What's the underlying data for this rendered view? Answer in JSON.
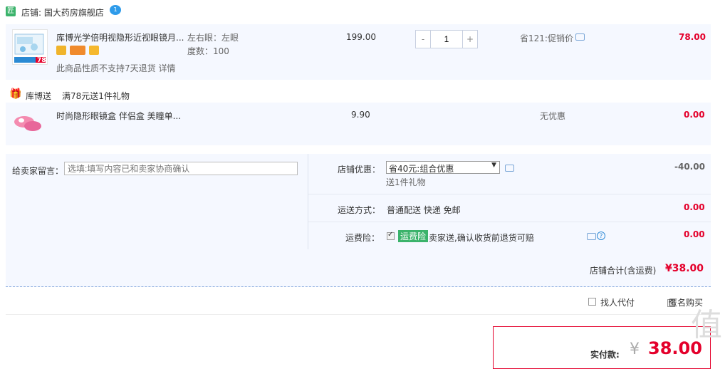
{
  "shop": {
    "badge": "匠",
    "name": "店铺: 国大药房旗舰店",
    "wangwang_count": "1"
  },
  "item": {
    "title": "库博光学倍明视隐形近视眼镜月...",
    "spec_eye": "左右眼：左眼",
    "spec_degree": "度数：100",
    "unit_price": "199.00",
    "quantity": "1",
    "minus": "-",
    "plus": "+",
    "discount_text": "省121:促销价",
    "subtotal": "78.00",
    "return_notice": "此商品性质不支持7天退货 详情",
    "thumb_price_tag": "78"
  },
  "gift_header": {
    "label": "库博送",
    "desc": "满78元送1件礼物"
  },
  "gift_item": {
    "title": "时尚隐形眼镜盒 伴侣盒 美瞳单...",
    "unit_price": "9.90",
    "discount_text": "无优惠",
    "subtotal": "0.00"
  },
  "memo": {
    "label": "给卖家留言：",
    "placeholder": "选填:填写内容已和卖家协商确认"
  },
  "coupon": {
    "label": "店铺优惠：",
    "selected": "省40元:组合优惠",
    "gift_note": "送1件礼物",
    "amount": "-40.00"
  },
  "shipping": {
    "label": "运送方式：",
    "value": "普通配送 快递 免邮",
    "amount": "0.00"
  },
  "insurance": {
    "label": "运费险：",
    "tag": "运费险",
    "desc": "卖家送,确认收货前退货可赔",
    "amount": "0.00"
  },
  "shop_total": {
    "label": "店铺合计(含运费)",
    "value": "¥38.00"
  },
  "options": {
    "proxy_pay": "找人代付",
    "anonymous": "匿名购买"
  },
  "payment": {
    "label": "实付款:",
    "currency": "¥",
    "value": "38.00"
  },
  "watermark": "值",
  "colors": {
    "accent_red": "#e4002b",
    "row_bg": "#f5f8ff",
    "badge_green": "#3bb36b"
  }
}
